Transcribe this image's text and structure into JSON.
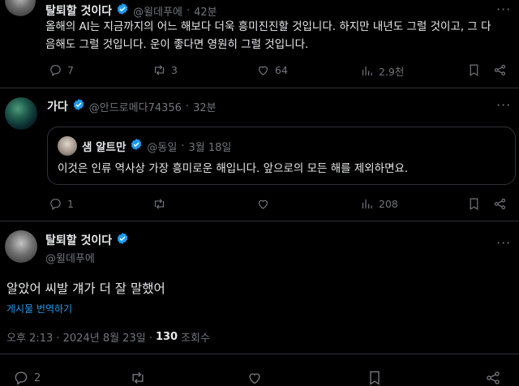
{
  "tweet1": {
    "display_name": "탈퇴할 것이다",
    "handle": "@윌데푸에",
    "separator": "·",
    "time": "42분",
    "text_line1": "올해의 AI는 지금까지의 어느 해보다 더욱 흥미진진할 것입니다. 하지만 내년도 그럴 것이고, 그 다",
    "text_line2": "음해도 그럴 것입니다. 운이 좋다면 영원히 그럴 것입니다.",
    "replies": "7",
    "retweets": "3",
    "likes": "64",
    "views": "2.9천"
  },
  "tweet2": {
    "display_name": "가다",
    "handle": "@안드로메다74356",
    "separator": "·",
    "time": "32분",
    "quote": {
      "display_name": "샘 알트만",
      "handle": "@동일",
      "separator": "·",
      "time": "3월 18일",
      "text": "이것은 인류 역사상 가장 흥미로운 해입니다. 앞으로의 모든 해를 제외하면요."
    },
    "replies": "1",
    "views": "208"
  },
  "tweet3": {
    "display_name": "탈퇴할 것이다",
    "handle": "@윌데푸에",
    "text": "알았어 씨발 걔가 더 잘 말했어",
    "translate_label": "게시물 번역하기",
    "timestamp": "오후 2:13 · 2024년 8월 23일 ·",
    "view_count": "130",
    "view_label": "조회수",
    "replies": "2"
  },
  "colors": {
    "background": "#000000",
    "text": "#e7e9ea",
    "muted": "#71767b",
    "accent": "#1d9bf0",
    "divider": "#2f3336"
  },
  "icons": [
    "verified-badge-icon",
    "reply-icon",
    "retweet-icon",
    "like-icon",
    "views-icon",
    "bookmark-icon",
    "share-icon",
    "more-icon"
  ]
}
